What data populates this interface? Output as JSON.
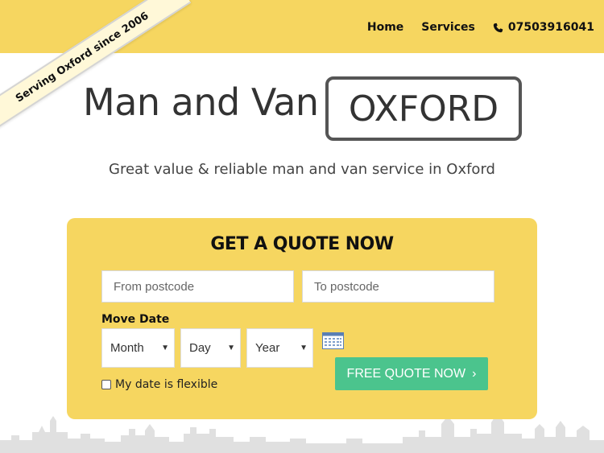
{
  "ribbon": {
    "text": "Serving Oxford since 2006"
  },
  "nav": {
    "home": "Home",
    "services": "Services",
    "phone": "07503916041",
    "phone_icon": "phone-icon"
  },
  "hero": {
    "title": "Man and Van",
    "brand": "OXFORD",
    "subtitle": "Great value & reliable man and van service in Oxford"
  },
  "quote": {
    "title": "GET A QUOTE NOW",
    "from_placeholder": "From postcode",
    "to_placeholder": "To postcode",
    "move_date_label": "Move Date",
    "month": "Month",
    "day": "Day",
    "year": "Year",
    "calendar_icon": "calendar-icon",
    "flexible_label": "My date is flexible",
    "submit_label": "FREE QUOTE NOW",
    "submit_icon": "chevron-right-icon"
  },
  "colors": {
    "brand_yellow": "#f6d660",
    "cta_green": "#4bc48d",
    "skyline_grey": "#e0e0e0"
  }
}
